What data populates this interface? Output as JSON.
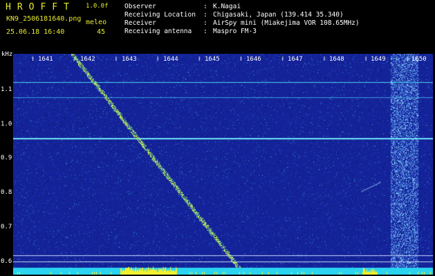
{
  "header": {
    "title": "HROFFT",
    "version": "1.0.0f",
    "filename": "KN9_2506181640.png",
    "meleo_label": "meleo",
    "timestamp": "25.06.18 16:40",
    "meleo_value": "45"
  },
  "info": [
    {
      "key": "Observer",
      "value": "K.Nagai"
    },
    {
      "key": "Receiving Location",
      "value": "Chigasaki, Japan (139.414 35.340)"
    },
    {
      "key": "Receiver",
      "value": "AirSpy mini (Miakejima VOR 108.65MHz)"
    },
    {
      "key": "Receiving antenna",
      "value": "Maspro FM-3"
    }
  ],
  "axis": {
    "y_unit": "kHz",
    "y_ticks": [
      "1.1",
      "1.0",
      "0.9",
      "0.8",
      "0.7",
      "0.6"
    ],
    "x_ticks": [
      "1641",
      "1642",
      "1643",
      "1644",
      "1645",
      "1646",
      "1647",
      "1648",
      "1649",
      "1650"
    ]
  },
  "colors": {
    "background": "#14239a",
    "text_accent": "#e8ec30",
    "trace": "#d8f04a"
  }
}
